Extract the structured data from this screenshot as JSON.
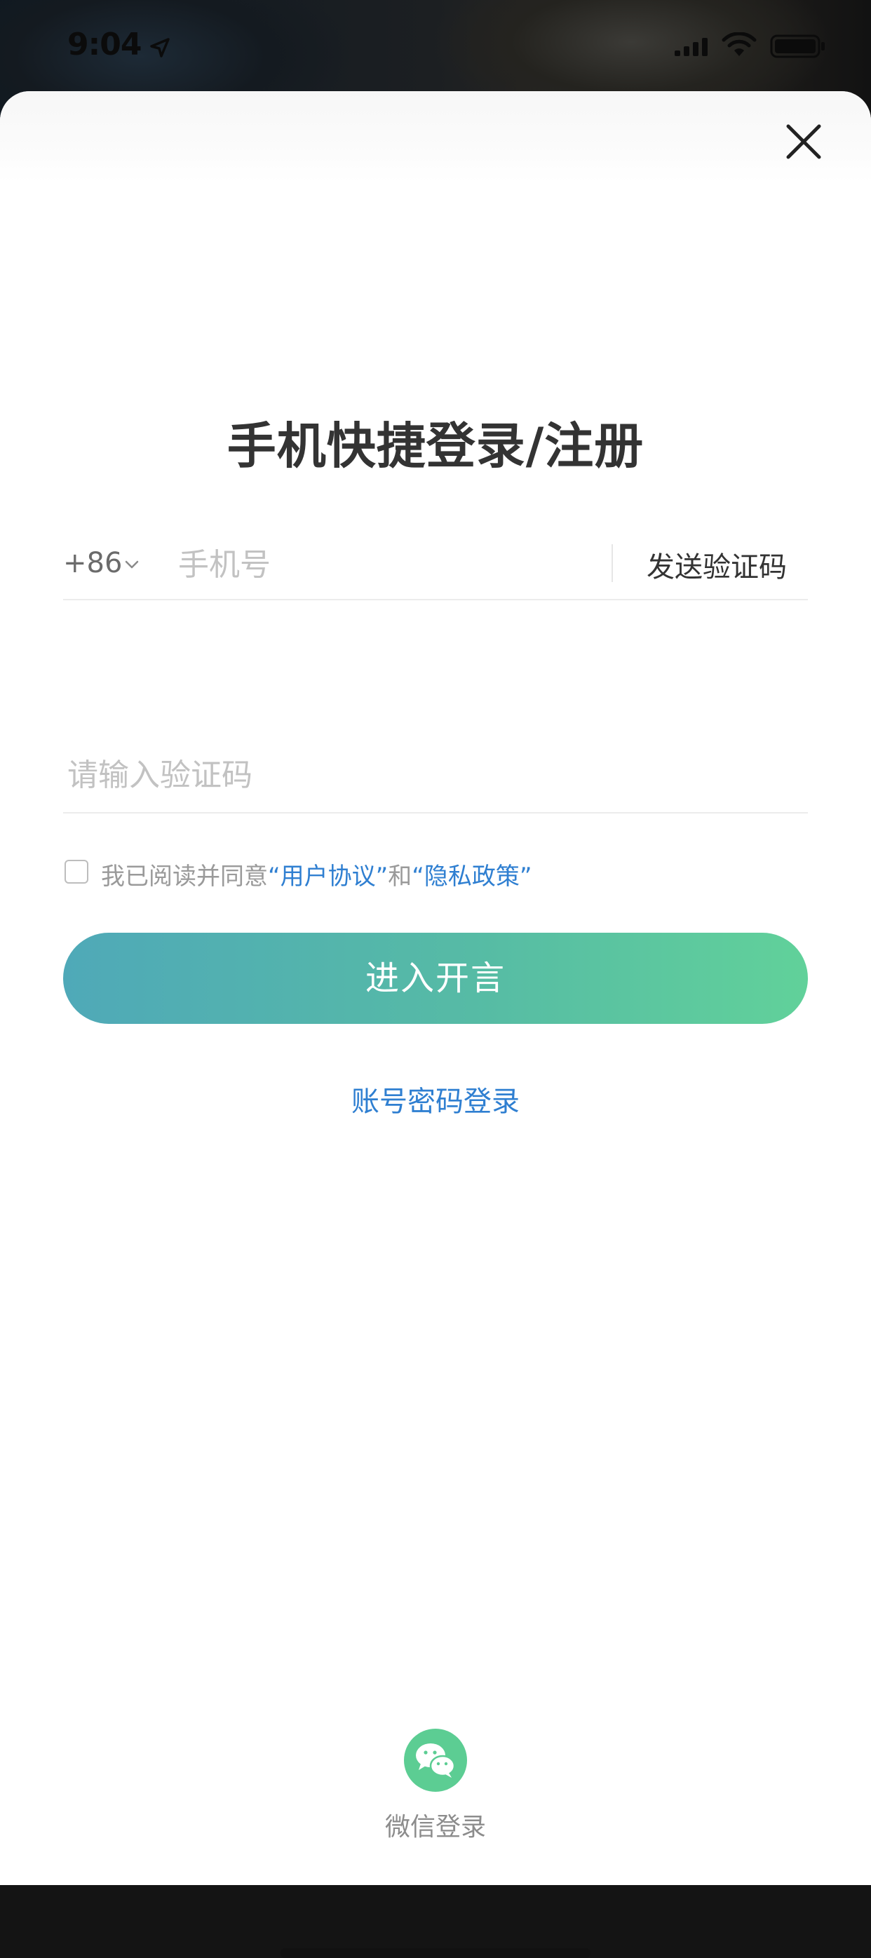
{
  "status_bar": {
    "time": "9:04"
  },
  "title": "手机快捷登录/注册",
  "phone": {
    "country_code": "+86",
    "placeholder": "手机号",
    "send_code_label": "发送验证码"
  },
  "verification": {
    "placeholder": "请输入验证码"
  },
  "agreement": {
    "prefix": "我已阅读并同意",
    "user_agreement": "“用户协议”",
    "conjunction": "和",
    "privacy_policy": "“隐私政策”",
    "checked": false
  },
  "enter_button_label": "进入开言",
  "password_login_label": "账号密码登录",
  "wechat_login_label": "微信登录",
  "colors": {
    "accent_blue": "#2f7fd1",
    "button_gradient_start": "#4fa9b8",
    "button_gradient_end": "#61d19a",
    "wechat_green": "#5ccd93"
  },
  "icons": {
    "close": "close-icon",
    "chevron": "chevron-down-icon",
    "wechat": "wechat-icon",
    "location": "location-arrow-icon",
    "signal": "cellular-signal-icon",
    "wifi": "wifi-icon",
    "battery": "battery-icon"
  }
}
